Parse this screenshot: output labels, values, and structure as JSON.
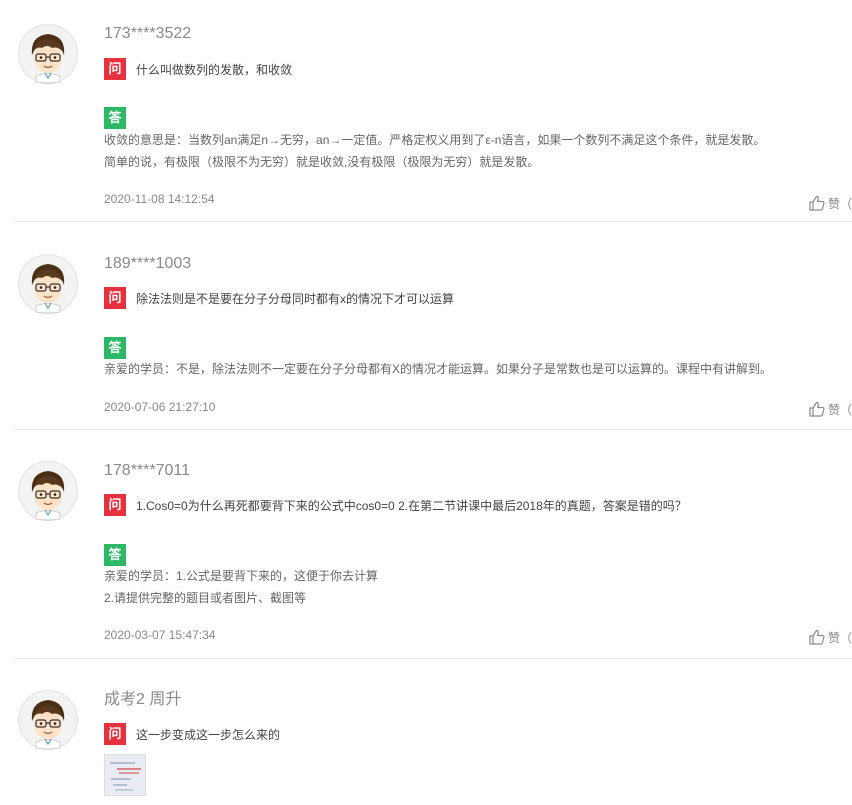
{
  "comments": [
    {
      "user": "173****3522",
      "q_badge": "问",
      "question": "什么叫做数列的发散，和收敛",
      "a_badge": "答",
      "answer": [
        "收敛的意思是：当数列an满足n→无穷，an→一定值。严格定权义用到了ε-n语言，如果一个数列不满足这个条件，就是发散。",
        "简单的说，有极限（极限不为无穷）就是收敛,没有极限（极限为无穷）就是发散。"
      ],
      "date": "2020-11-08 14:12:54",
      "like_label": "赞（"
    },
    {
      "user": "189****1003",
      "q_badge": "问",
      "question": "除法法则是不是要在分子分母同时都有x的情况下才可以运算",
      "a_badge": "答",
      "answer": [
        "亲爱的学员：不是，除法法则不一定要在分子分母都有X的情况才能运算。如果分子是常数也是可以运算的。课程中有讲解到。"
      ],
      "date": "2020-07-06 21:27:10",
      "like_label": "赞（"
    },
    {
      "user": "178****7011",
      "q_badge": "问",
      "question": "1.Cos0=0为什么再死都要背下来的公式中cos0=0 2.在第二节讲课中最后2018年的真题，答案是错的吗？",
      "a_badge": "答",
      "answer": [
        "亲爱的学员：1.公式是要背下来的，这便于你去计算",
        "2.请提供完整的题目或者图片、截图等"
      ],
      "date": "2020-03-07 15:47:34",
      "like_label": "赞（"
    },
    {
      "user": "成考2 周升",
      "q_badge": "问",
      "question": "这一步变成这一步怎么来的"
    }
  ],
  "colors": {
    "question_badge": "#e5323e",
    "answer_badge": "#2db866"
  },
  "icons": {
    "avatar": "cartoon-boy-with-glasses-avatar",
    "like": "thumbs-up-icon"
  }
}
